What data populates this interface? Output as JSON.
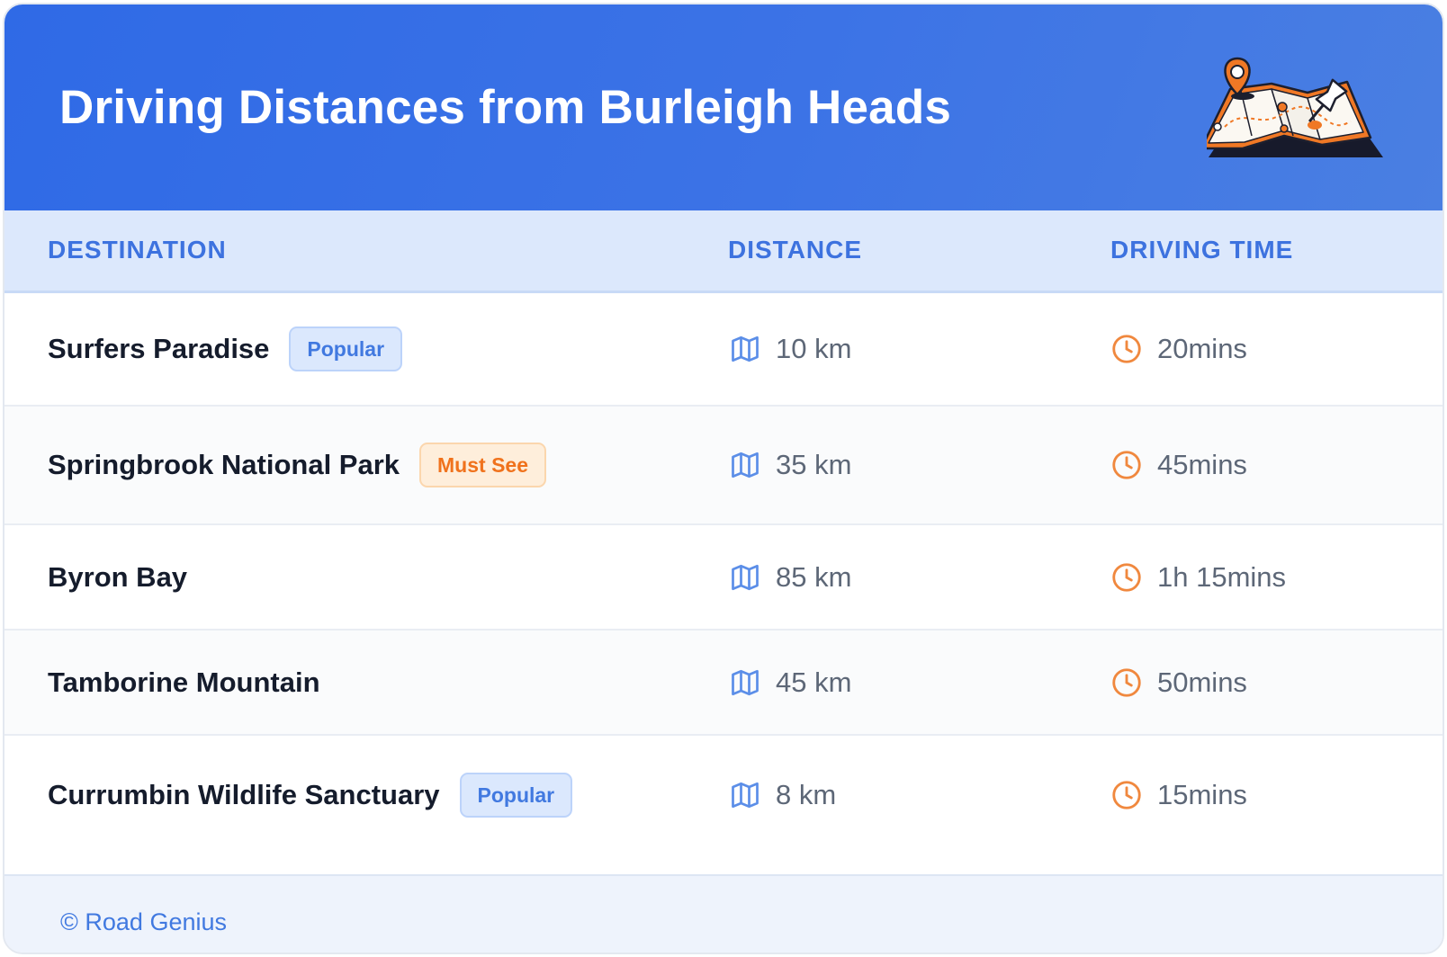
{
  "header": {
    "title": "Driving Distances from Burleigh Heads",
    "illustration_icon": "map-with-pins-icon"
  },
  "table": {
    "columns": {
      "destination": "DESTINATION",
      "distance": "DISTANCE",
      "driving_time": "DRIVING TIME"
    },
    "rows": [
      {
        "destination": "Surfers Paradise",
        "badge": "Popular",
        "badge_color": "blue",
        "distance": "10 km",
        "time": "20mins"
      },
      {
        "destination": "Springbrook National Park",
        "badge": "Must See",
        "badge_color": "orange",
        "distance": "35 km",
        "time": "45mins"
      },
      {
        "destination": "Byron Bay",
        "badge": "",
        "badge_color": "",
        "distance": "85 km",
        "time": "1h 15mins"
      },
      {
        "destination": "Tamborine Mountain",
        "badge": "",
        "badge_color": "",
        "distance": "45 km",
        "time": "50mins"
      },
      {
        "destination": "Currumbin Wildlife Sanctuary",
        "badge": "Popular",
        "badge_color": "blue",
        "distance": "8 km",
        "time": "15mins"
      }
    ],
    "distance_icon": "map-icon",
    "time_icon": "clock-icon"
  },
  "footer": {
    "text": "© Road Genius"
  },
  "colors": {
    "header_gradient_start": "#2f6ae6",
    "header_gradient_end": "#4a7fe2",
    "accent_blue": "#3d72df",
    "accent_orange": "#f0721c",
    "table_header_bg": "#dce8fc",
    "footer_bg": "#eef3fc"
  }
}
